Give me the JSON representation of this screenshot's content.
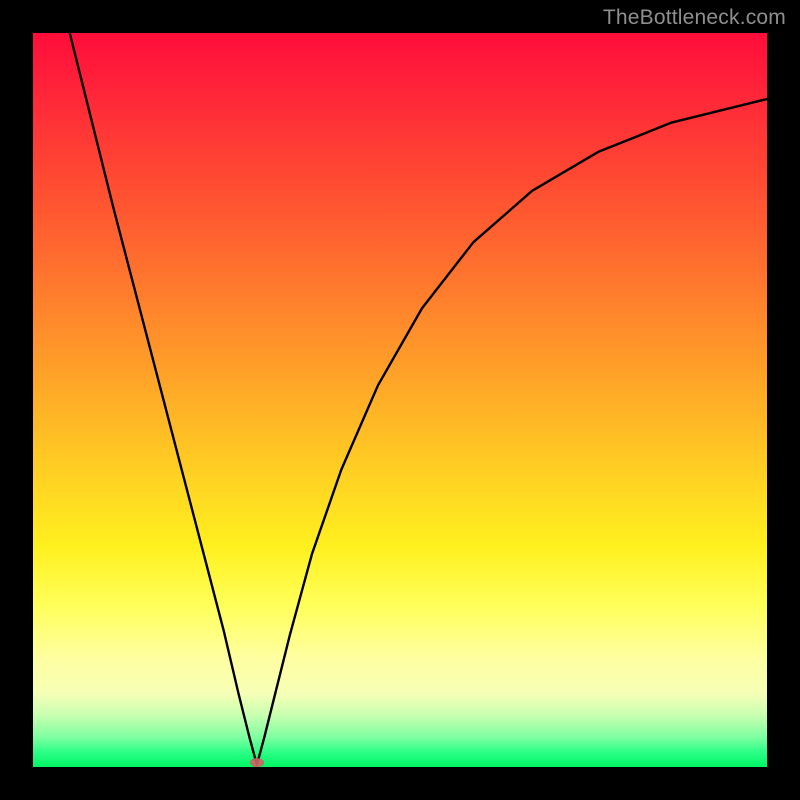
{
  "watermark": "TheBottleneck.com",
  "colors": {
    "background": "#000000",
    "curve_stroke": "#000000",
    "marker_fill": "#d06565"
  },
  "chart_data": {
    "type": "line",
    "title": "",
    "xlabel": "",
    "ylabel": "",
    "xlim": [
      0,
      100
    ],
    "ylim": [
      0,
      100
    ],
    "grid": false,
    "annotations": [
      {
        "kind": "marker",
        "x": 30.5,
        "y": 0.5,
        "shape": "ellipse",
        "color": "#d06565"
      }
    ],
    "series": [
      {
        "name": "curve",
        "x": [
          5,
          8,
          11,
          14,
          17,
          20,
          23,
          26,
          28,
          29.5,
          30.5,
          31.5,
          33,
          35,
          38,
          42,
          47,
          53,
          60,
          68,
          77,
          87,
          100
        ],
        "y": [
          100,
          88,
          76,
          64.5,
          53,
          41.5,
          30,
          18.5,
          10,
          4,
          0.3,
          4,
          10,
          18,
          29,
          40.5,
          52,
          62.5,
          71.5,
          78.5,
          83.8,
          87.8,
          91
        ]
      }
    ]
  }
}
